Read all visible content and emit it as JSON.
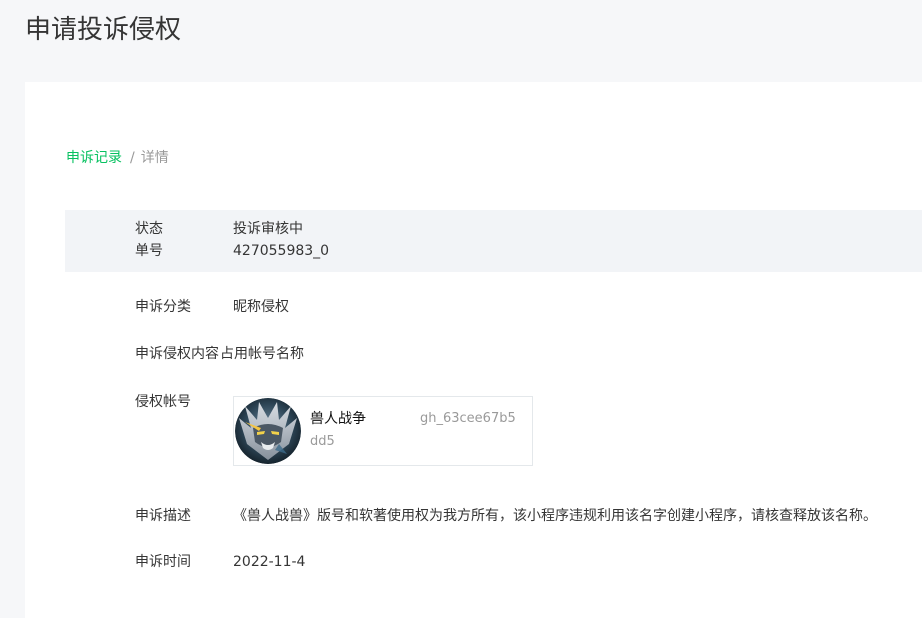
{
  "page": {
    "title": "申请投诉侵权"
  },
  "breadcrumb": {
    "parent": "申诉记录",
    "separator": "/",
    "current": "详情"
  },
  "status": {
    "state_label": "状态",
    "state_value": "投诉审核中",
    "number_label": "单号",
    "number_value": "427055983_0"
  },
  "details": {
    "category_label": "申诉分类",
    "category_value": "昵称侵权",
    "content_label": "申诉侵权内容",
    "content_value": "占用帐号名称",
    "account_label": "侵权帐号",
    "account": {
      "name": "兽人战争",
      "id_part1": "gh_63cee67b5",
      "id_part2": "dd5",
      "avatar_icon": "orc-warrior-avatar-icon"
    },
    "description_label": "申诉描述",
    "description_value": "《兽人战兽》版号和软著使用权为我方所有，该小程序违规利用该名字创建小程序，请核查释放该名称。",
    "time_label": "申诉时间",
    "time_value": "2022-11-4"
  },
  "colors": {
    "accent": "#07c160",
    "background": "#f6f7f9",
    "band": "#f2f4f7",
    "muted": "#9a9a9a"
  }
}
